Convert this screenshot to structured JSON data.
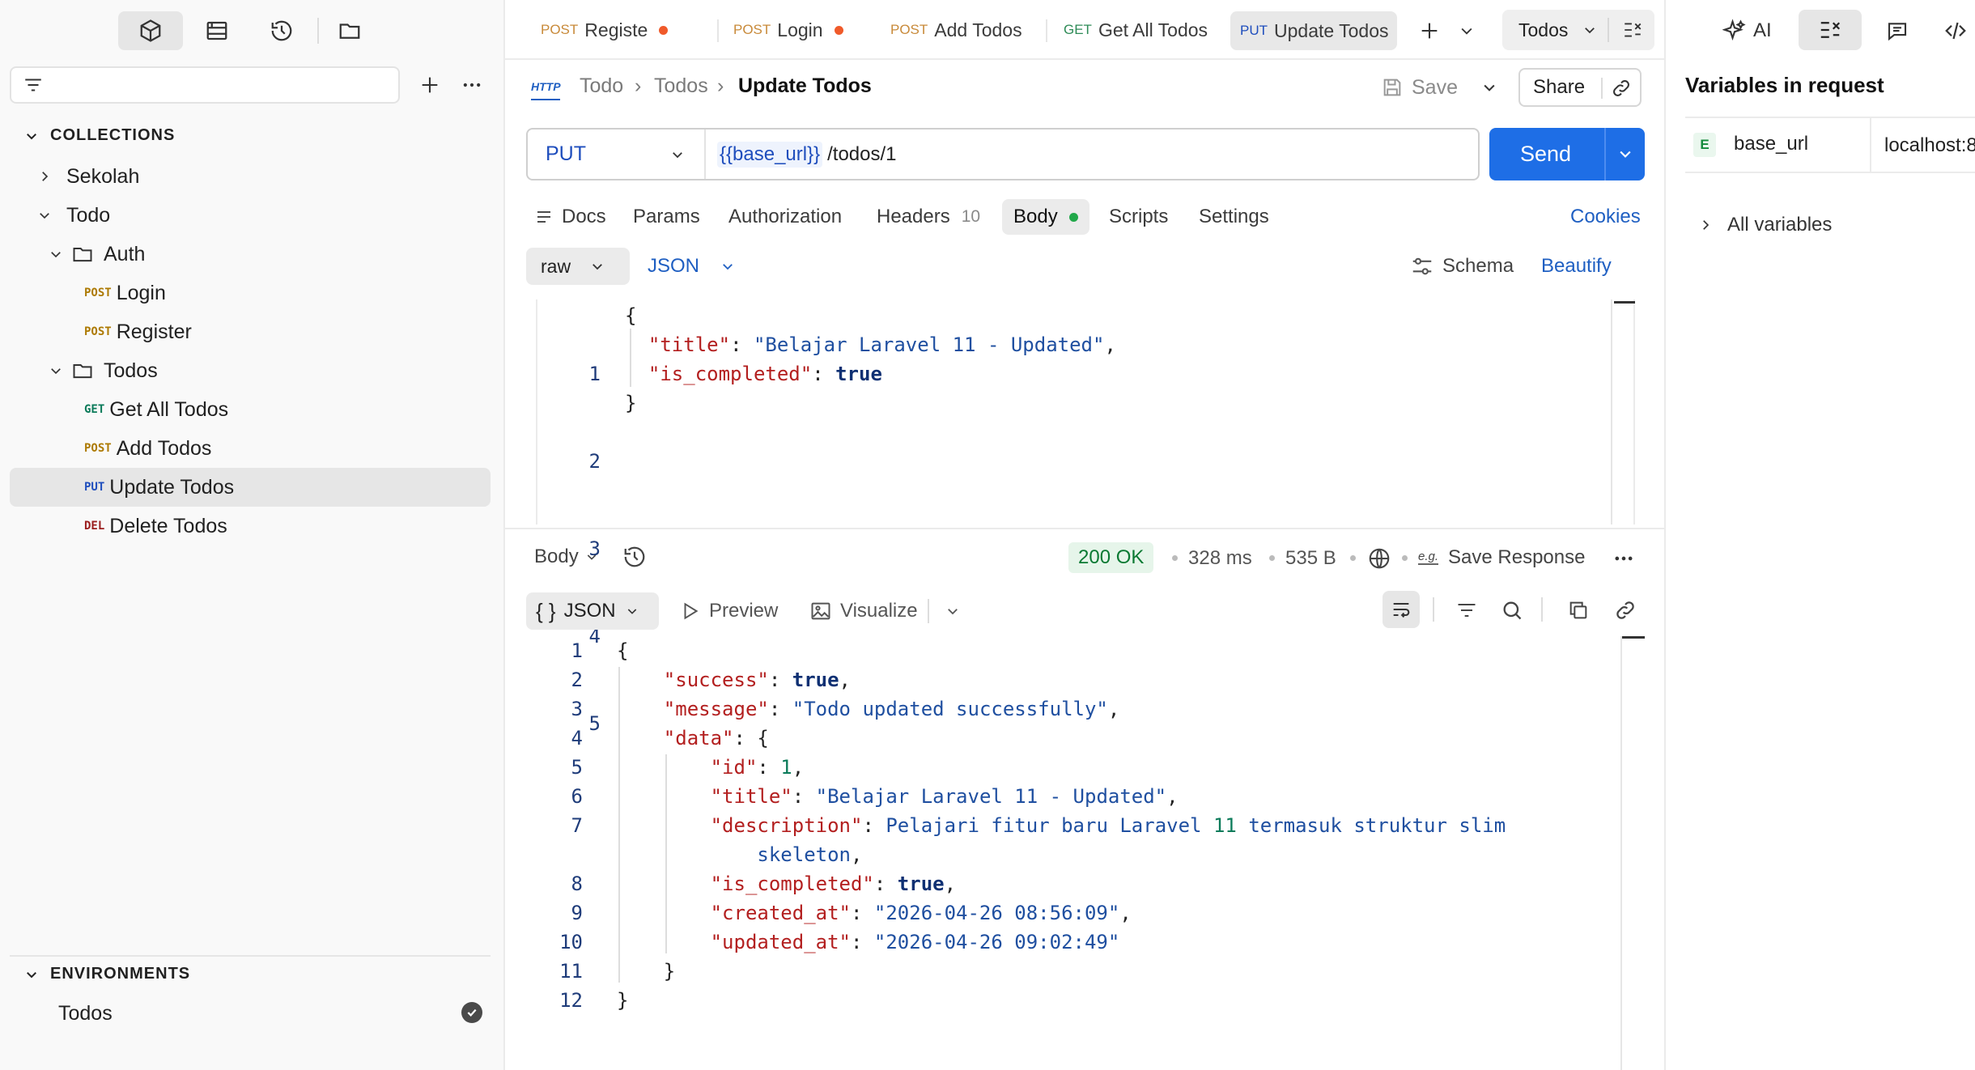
{
  "sidebar": {
    "section_collections": "COLLECTIONS",
    "section_environments": "ENVIRONMENTS",
    "collections": [
      {
        "label": "Sekolah"
      },
      {
        "label": "Todo"
      }
    ],
    "folders": [
      {
        "label": "Auth"
      },
      {
        "label": "Todos"
      }
    ],
    "requests": [
      {
        "method": "POST",
        "label": "Login"
      },
      {
        "method": "POST",
        "label": "Register"
      },
      {
        "method": "GET",
        "label": "Get All Todos"
      },
      {
        "method": "POST",
        "label": "Add Todos"
      },
      {
        "method": "PUT",
        "label": "Update Todos"
      },
      {
        "method": "DEL",
        "label": "Delete Todos"
      }
    ],
    "environments": [
      {
        "label": "Todos"
      }
    ]
  },
  "tabs": [
    {
      "method": "POST",
      "label": "Registe"
    },
    {
      "method": "POST",
      "label": "Login"
    },
    {
      "method": "POST",
      "label": "Add Todos"
    },
    {
      "method": "GET",
      "label": "Get All Todos"
    },
    {
      "method": "PUT",
      "label": "Update Todos"
    }
  ],
  "env_select": "Todos",
  "breadcrumb": {
    "http": "HTTP",
    "c1": "Todo",
    "c2": "Todos",
    "current": "Update Todos"
  },
  "actions": {
    "save": "Save",
    "share": "Share"
  },
  "request": {
    "method": "PUT",
    "url_var": "{{base_url}}",
    "url_path": "/todos/1",
    "send": "Send"
  },
  "request_tabs": {
    "docs": "Docs",
    "params": "Params",
    "authorization": "Authorization",
    "headers": "Headers",
    "headers_count": "10",
    "body": "Body",
    "scripts": "Scripts",
    "settings": "Settings",
    "cookies": "Cookies"
  },
  "body_bar": {
    "mode": "raw",
    "lang": "JSON",
    "schema": "Schema",
    "beautify": "Beautify"
  },
  "request_body": [
    {
      "n": "1",
      "t": "{"
    },
    {
      "n": "2",
      "t": "  \"title\": \"Belajar Laravel 11 - Updated\","
    },
    {
      "n": "3",
      "t": "  \"is_completed\": true"
    },
    {
      "n": "4",
      "t": "}"
    },
    {
      "n": "5",
      "t": ""
    }
  ],
  "response": {
    "body_label": "Body",
    "status": "200 OK",
    "time": "328 ms",
    "size": "535 B",
    "save_eg": "e.g.",
    "save": "Save Response",
    "format": "JSON",
    "preview": "Preview",
    "visualize": "Visualize",
    "lines": [
      {
        "n": "1",
        "t": "{"
      },
      {
        "n": "2",
        "t": "    \"success\": true,"
      },
      {
        "n": "3",
        "t": "    \"message\": \"Todo updated successfully\","
      },
      {
        "n": "4",
        "t": "    \"data\": {"
      },
      {
        "n": "5",
        "t": "        \"id\": 1,"
      },
      {
        "n": "6",
        "t": "        \"title\": \"Belajar Laravel 11 - Updated\","
      },
      {
        "n": "7",
        "t": "        \"description\": \"Pelajari fitur baru Laravel 11 termasuk struktur slim"
      },
      {
        "n": "",
        "t": "            skeleton\","
      },
      {
        "n": "8",
        "t": "        \"is_completed\": true,"
      },
      {
        "n": "9",
        "t": "        \"created_at\": \"2026-04-26 08:56:09\","
      },
      {
        "n": "10",
        "t": "        \"updated_at\": \"2026-04-26 09:02:49\""
      },
      {
        "n": "11",
        "t": "    }"
      },
      {
        "n": "12",
        "t": "}"
      }
    ]
  },
  "right_panel": {
    "ai": "AI",
    "title": "Variables in request",
    "var_scope": "E",
    "var_name": "base_url",
    "var_value": "localhost:8",
    "all_variables": "All variables"
  }
}
